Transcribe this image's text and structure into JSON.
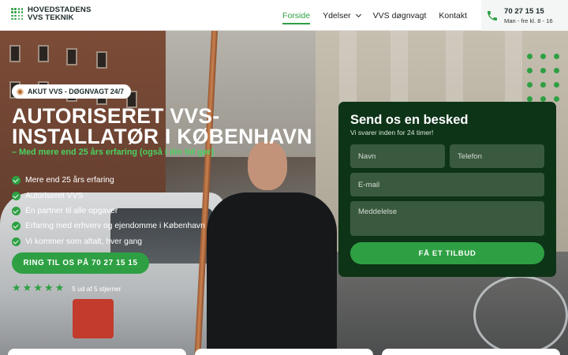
{
  "header": {
    "logo_line1": "HOVEDSTADENS",
    "logo_line2": "VVS TEKNIK",
    "nav": [
      {
        "label": "Forside",
        "active": true
      },
      {
        "label": "Ydelser",
        "dropdown": true
      },
      {
        "label": "VVS døgnvagt"
      },
      {
        "label": "Kontakt"
      }
    ],
    "contact_phone": "70 27 15 15",
    "contact_hours": "Man - fre kl. 8 - 16"
  },
  "hero": {
    "badge": "AKUT VVS - DØGNVAGT 24/7",
    "title": "AUTORISERET VVS-INSTALLATØR I KØBENHAVN",
    "subtitle": "– Med mere end 25 års erfaring (også i din tid gør)",
    "features": [
      "Mere end 25 års erfaring",
      "Autoriseret VVS",
      "Én partner til alle opgaver",
      "Erfaring med erhverv og ejendomme i København",
      "Vi kommer som aftalt, hver gang"
    ],
    "call_button": "RING TIL OS PÅ 70 27 15 15",
    "rating_value": 5,
    "rating_text": "5 ud af 5 stjerner"
  },
  "form": {
    "title": "Send os en besked",
    "subtitle": "Vi svarer inden for 24 timer!",
    "name_placeholder": "Navn",
    "phone_placeholder": "Telefon",
    "email_placeholder": "E-mail",
    "message_placeholder": "Meddelelse",
    "submit": "FÅ ET TILBUD"
  },
  "colors": {
    "accent": "#2ea043",
    "form_bg": "#0e3418",
    "field_bg": "#3a5a3f"
  }
}
